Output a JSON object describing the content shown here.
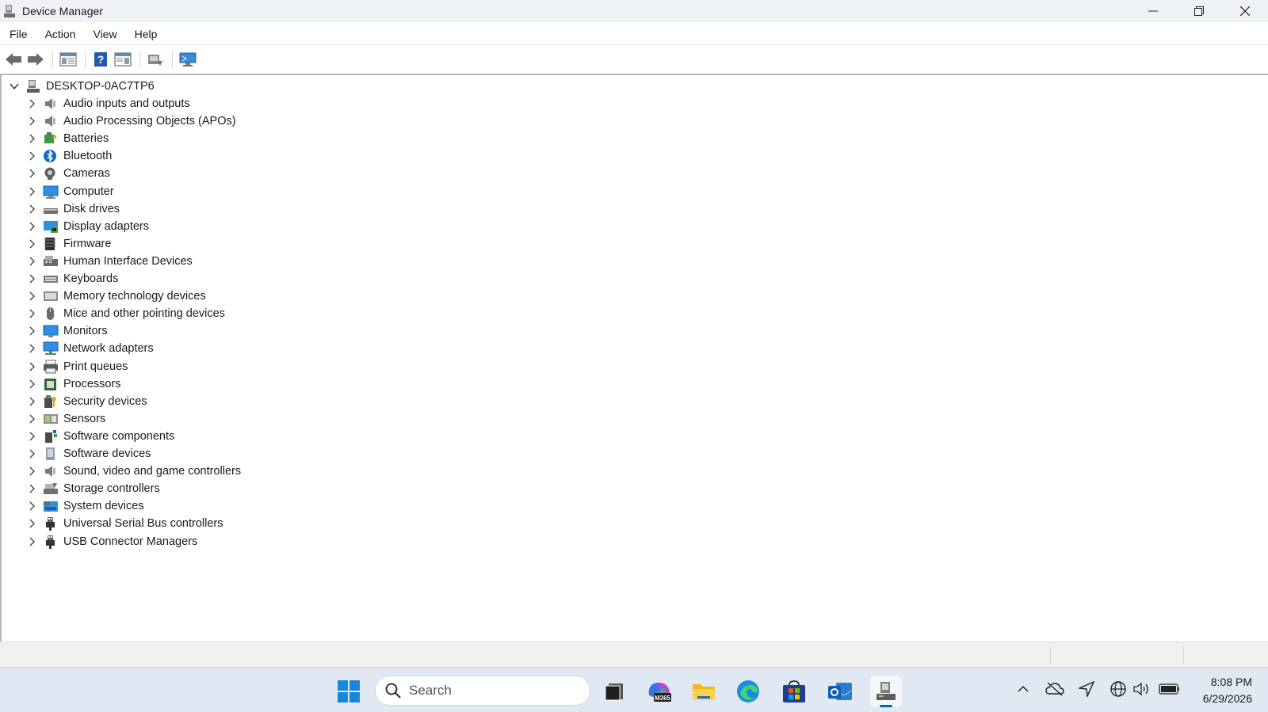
{
  "window": {
    "title": "Device Manager"
  },
  "menu": [
    "File",
    "Action",
    "View",
    "Help"
  ],
  "tree": {
    "root": "DESKTOP-0AC7TP6",
    "categories": [
      {
        "label": "Audio inputs and outputs",
        "icon": "speaker-icon"
      },
      {
        "label": "Audio Processing Objects (APOs)",
        "icon": "speaker-icon"
      },
      {
        "label": "Batteries",
        "icon": "battery-icon"
      },
      {
        "label": "Bluetooth",
        "icon": "bluetooth-icon"
      },
      {
        "label": "Cameras",
        "icon": "camera-icon"
      },
      {
        "label": "Computer",
        "icon": "computer-icon"
      },
      {
        "label": "Disk drives",
        "icon": "disk-drive-icon"
      },
      {
        "label": "Display adapters",
        "icon": "display-adapter-icon"
      },
      {
        "label": "Firmware",
        "icon": "firmware-icon"
      },
      {
        "label": "Human Interface Devices",
        "icon": "hid-icon"
      },
      {
        "label": "Keyboards",
        "icon": "keyboard-icon"
      },
      {
        "label": "Memory technology devices",
        "icon": "memory-icon"
      },
      {
        "label": "Mice and other pointing devices",
        "icon": "mouse-icon"
      },
      {
        "label": "Monitors",
        "icon": "monitor-icon"
      },
      {
        "label": "Network adapters",
        "icon": "network-adapter-icon"
      },
      {
        "label": "Print queues",
        "icon": "printer-icon"
      },
      {
        "label": "Processors",
        "icon": "processor-icon"
      },
      {
        "label": "Security devices",
        "icon": "security-device-icon"
      },
      {
        "label": "Sensors",
        "icon": "sensor-icon"
      },
      {
        "label": "Software components",
        "icon": "software-component-icon"
      },
      {
        "label": "Software devices",
        "icon": "software-device-icon"
      },
      {
        "label": "Sound, video and game controllers",
        "icon": "speaker-icon"
      },
      {
        "label": "Storage controllers",
        "icon": "storage-controller-icon"
      },
      {
        "label": "System devices",
        "icon": "system-devices-icon"
      },
      {
        "label": "Universal Serial Bus controllers",
        "icon": "usb-icon"
      },
      {
        "label": "USB Connector Managers",
        "icon": "usb-icon"
      }
    ]
  },
  "taskbar": {
    "search_placeholder": "Search",
    "time": "8:08 PM",
    "date": "6/29/2026"
  },
  "colors": {
    "accent": "#0067c0",
    "taskbar_bg": "#dfe8f3",
    "titlebar_bg": "#eef1f6"
  }
}
